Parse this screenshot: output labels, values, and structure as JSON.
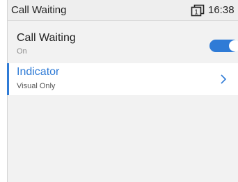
{
  "header": {
    "title": "Call Waiting",
    "line_number": "1",
    "time": "16:38"
  },
  "settings": {
    "call_waiting": {
      "label": "Call Waiting",
      "value": "On",
      "enabled": true
    },
    "indicator": {
      "label": "Indicator",
      "value": "Visual Only"
    }
  },
  "colors": {
    "accent": "#2f7bd6",
    "background": "#f2f2f2",
    "selected_row": "#ffffff"
  },
  "icons": {
    "line": "line-key-icon",
    "chevron": "chevron-right-icon"
  }
}
